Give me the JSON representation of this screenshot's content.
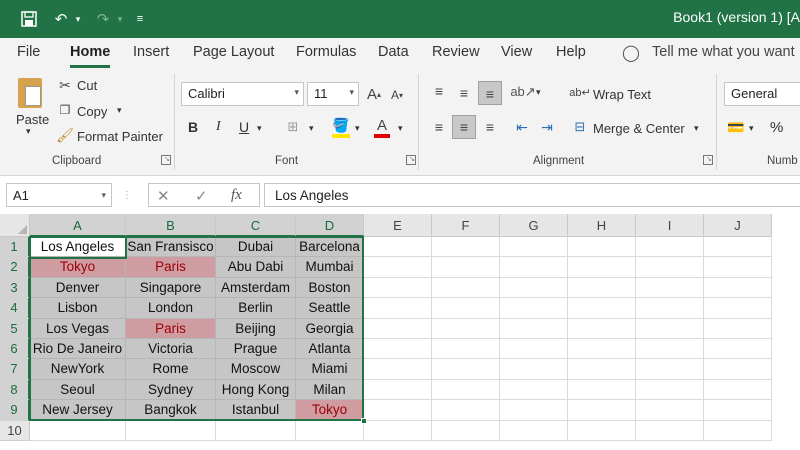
{
  "title_bar": {
    "document_title": "Book1 (version 1) [A"
  },
  "menu": {
    "tabs": [
      "File",
      "Home",
      "Insert",
      "Page Layout",
      "Formulas",
      "Data",
      "Review",
      "View",
      "Help"
    ],
    "tell_me": "Tell me what you want"
  },
  "ribbon": {
    "clipboard": {
      "paste": "Paste",
      "cut": "Cut",
      "copy": "Copy",
      "format_painter": "Format Painter",
      "label": "Clipboard"
    },
    "font": {
      "name": "Calibri",
      "size": "11",
      "bold": "B",
      "italic": "I",
      "underline": "U",
      "label": "Font"
    },
    "alignment": {
      "wrap_text": "Wrap Text",
      "merge_center": "Merge & Center",
      "label": "Alignment"
    },
    "number": {
      "format": "General",
      "percent": "%",
      "label": "Numb"
    }
  },
  "formula_bar": {
    "name_box": "A1",
    "fx": "fx",
    "content": "Los Angeles"
  },
  "grid": {
    "columns": [
      "A",
      "B",
      "C",
      "D",
      "E",
      "F",
      "G",
      "H",
      "I",
      "J"
    ],
    "rows": [
      "1",
      "2",
      "3",
      "4",
      "5",
      "6",
      "7",
      "8",
      "9",
      "10"
    ],
    "data": [
      [
        "Los Angeles",
        "San Fransisco",
        "Dubai",
        "Barcelona"
      ],
      [
        "Tokyo",
        "Paris",
        "Abu Dabi",
        "Mumbai"
      ],
      [
        "Denver",
        "Singapore",
        "Amsterdam",
        "Boston"
      ],
      [
        "Lisbon",
        "London",
        "Berlin",
        "Seattle"
      ],
      [
        "Los Vegas",
        "Paris",
        "Beijing",
        "Georgia"
      ],
      [
        "Rio De Janeiro",
        "Victoria",
        "Prague",
        "Atlanta"
      ],
      [
        "NewYork",
        "Rome",
        "Moscow",
        "Miami"
      ],
      [
        "Seoul",
        "Sydney",
        "Hong Kong",
        "Milan"
      ],
      [
        "New Jersey",
        "Bangkok",
        "Istanbul",
        "Tokyo"
      ]
    ],
    "highlight_color": "#cf9ca2",
    "highlight_text_color": "#9c0006",
    "accent_color": "#217346"
  }
}
